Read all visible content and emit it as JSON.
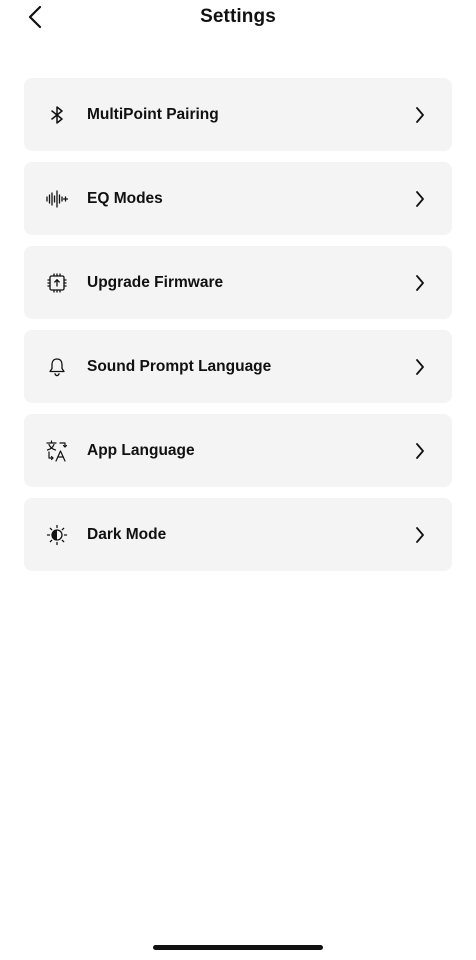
{
  "header": {
    "title": "Settings",
    "back_icon": "chevron-left-icon"
  },
  "items": [
    {
      "label": "MultiPoint Pairing",
      "icon": "bluetooth-icon"
    },
    {
      "label": "EQ Modes",
      "icon": "waveform-icon"
    },
    {
      "label": "Upgrade Firmware",
      "icon": "chip-upgrade-icon"
    },
    {
      "label": "Sound Prompt Language",
      "icon": "bell-icon"
    },
    {
      "label": "App Language",
      "icon": "translate-icon"
    },
    {
      "label": "Dark Mode",
      "icon": "contrast-sun-icon"
    }
  ],
  "colors": {
    "background": "#ffffff",
    "card": "#f4f4f4",
    "text": "#111111"
  }
}
